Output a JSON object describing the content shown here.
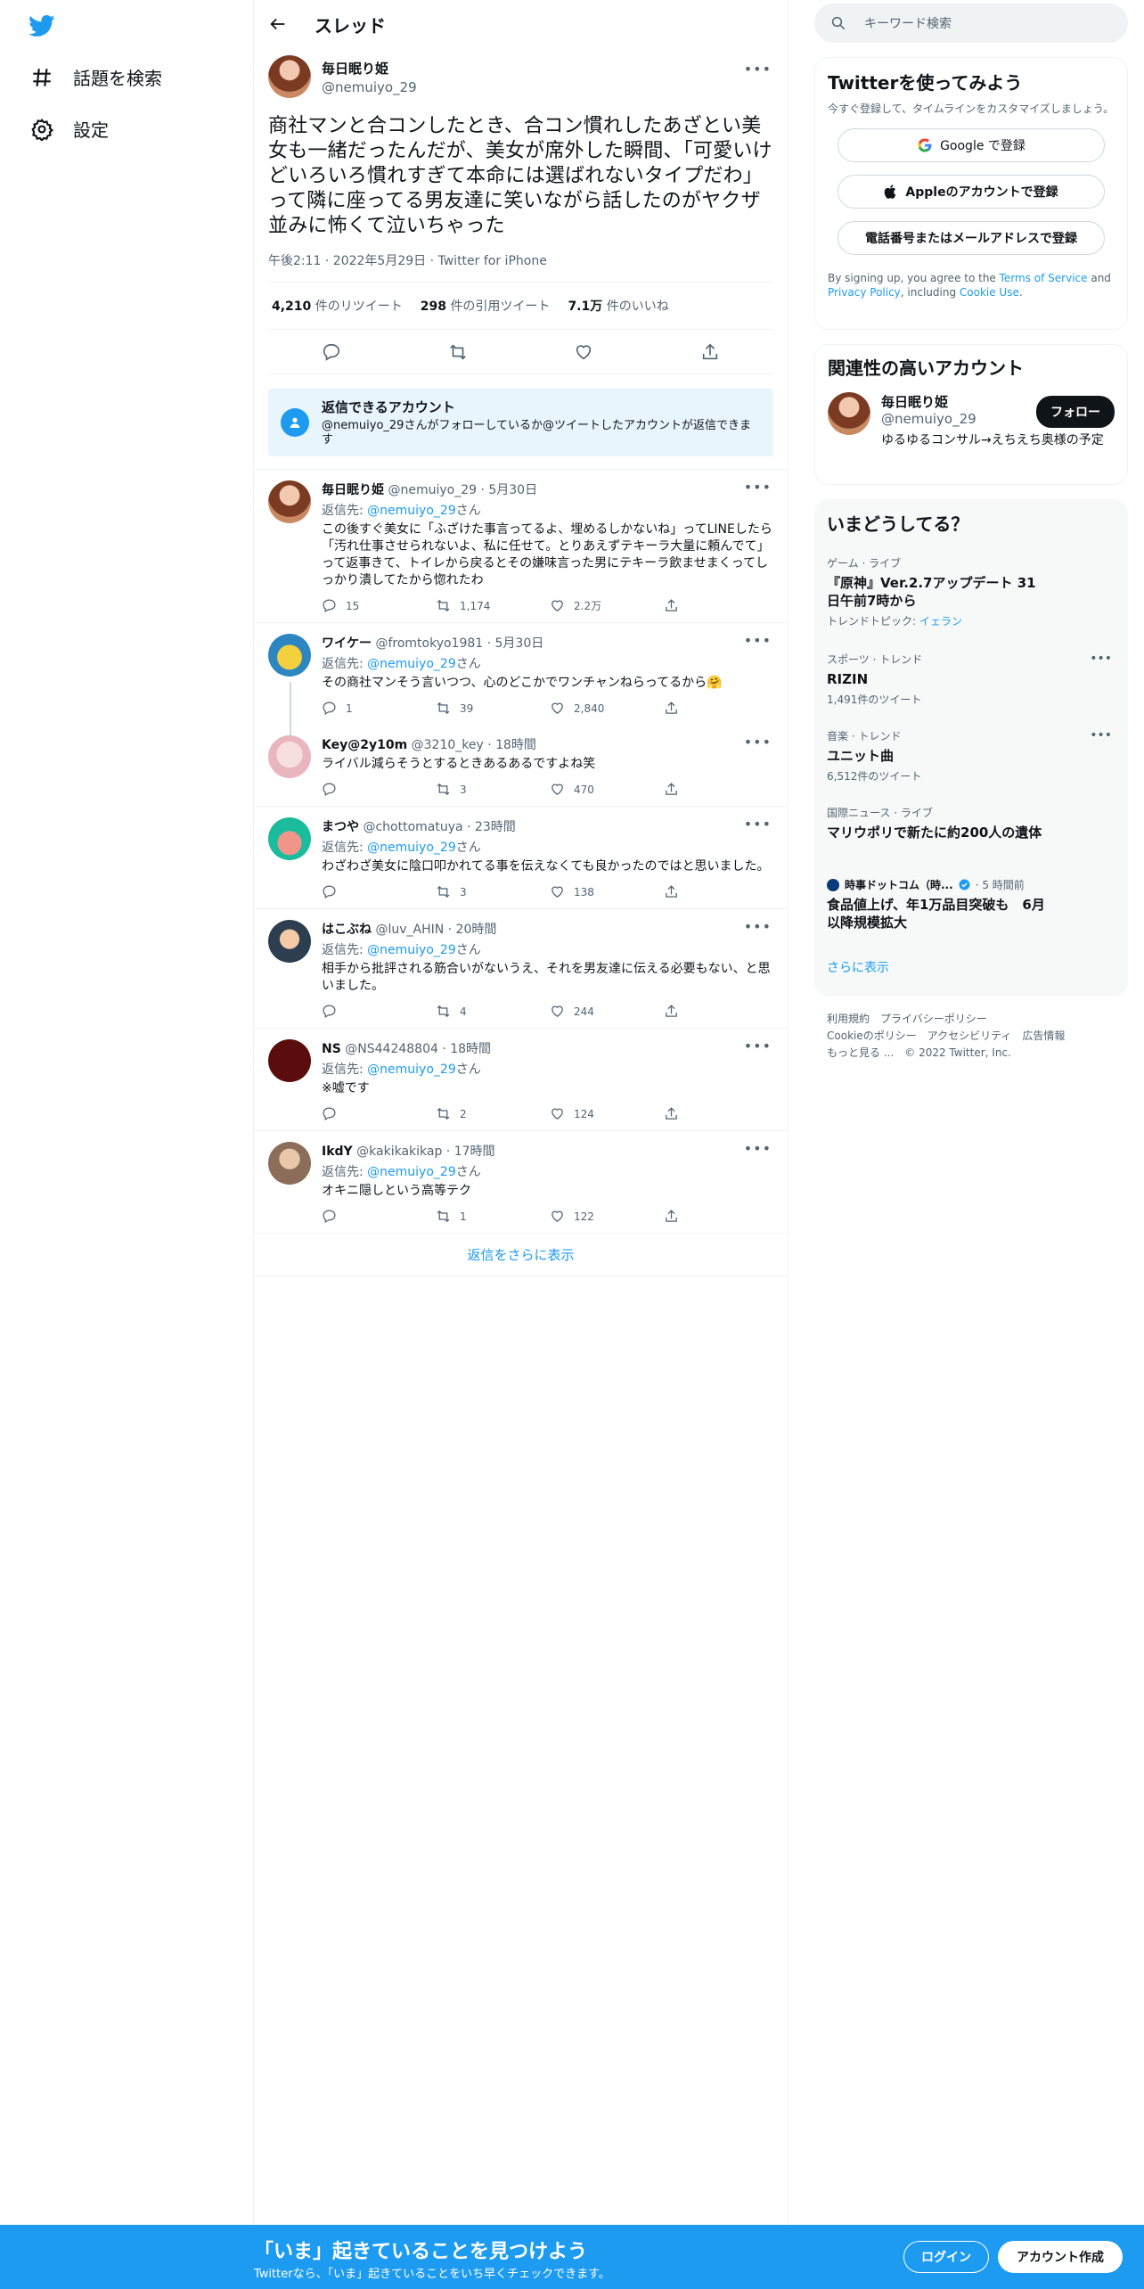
{
  "colors": {
    "accent": "#1d9bf0",
    "text": "#0f1419",
    "muted": "#536471"
  },
  "nav": {
    "explore_label": "話題を検索",
    "settings_label": "設定"
  },
  "header": {
    "title": "スレッド"
  },
  "tweet": {
    "name": "毎日眠り姫",
    "handle": "@nemuiyo_29",
    "text": "商社マンと合コンしたとき、合コン慣れしたあざとい美女も一緒だったんだが、美女が席外した瞬間、「可愛いけどいろいろ慣れすぎて本命には選ばれないタイプだわ」って隣に座ってる男友達に笑いながら話したのがヤクザ並みに怖くて泣いちゃった",
    "meta": "午後2:11 · 2022年5月29日 · Twitter for iPhone",
    "retweets": {
      "num": "4,210",
      "label": "件のリツイート"
    },
    "quotes": {
      "num": "298",
      "label": "件の引用ツイート"
    },
    "likes": {
      "num": "7.1万",
      "label": "件のいいね"
    }
  },
  "who_can_reply": {
    "title": "返信できるアカウント",
    "text": "@nemuiyo_29さんがフォローしているか@ツイートしたアカウントが返信できます"
  },
  "replies": [
    {
      "name": "毎日眠り姫",
      "meta": "@nemuiyo_29 · 5月30日",
      "reply_prefix": "返信先: ",
      "reply_to": "@nemuiyo_29",
      "reply_suffix": "さん",
      "text": "この後すぐ美女に「ふざけた事言ってるよ、埋めるしかないね」ってLINEしたら「汚れ仕事させられないよ、私に任せて。とりあえずテキーラ大量に頼んでて」って返事きて、トイレから戻るとその嫌味言った男にテキーラ飲ませまくってしっかり潰してたから惚れたわ",
      "reply": "15",
      "retweet": "1,174",
      "like": "2.2万"
    },
    {
      "name": "ワイケー",
      "meta": "@fromtokyo1981 · 5月30日",
      "reply_prefix": "返信先: ",
      "reply_to": "@nemuiyo_29",
      "reply_suffix": "さん",
      "text": "その商社マンそう言いつつ、心のどこかでワンチャンねらってるから🤗",
      "reply": "1",
      "retweet": "39",
      "like": "2,840"
    },
    {
      "name": "Key@2y10m",
      "meta": "@3210_key · 18時間",
      "text": "ライバル減らそうとするときあるあるですよね笑",
      "reply": "",
      "retweet": "3",
      "like": "470"
    },
    {
      "name": "まつや",
      "meta": "@chottomatuya · 23時間",
      "reply_prefix": "返信先: ",
      "reply_to": "@nemuiyo_29",
      "reply_suffix": "さん",
      "text": "わざわざ美女に陰口叩かれてる事を伝えなくても良かったのではと思いました。",
      "reply": "",
      "retweet": "3",
      "like": "138"
    },
    {
      "name": "はこぶね",
      "meta": "@luv_AHIN · 20時間",
      "reply_prefix": "返信先: ",
      "reply_to": "@nemuiyo_29",
      "reply_suffix": "さん",
      "text": "相手から批評される筋合いがないうえ、それを男友達に伝える必要もない、と思いました。",
      "reply": "",
      "retweet": "4",
      "like": "244"
    },
    {
      "name": "NS",
      "meta": "@NS44248804 · 18時間",
      "reply_prefix": "返信先: ",
      "reply_to": "@nemuiyo_29",
      "reply_suffix": "さん",
      "text": "※嘘です",
      "reply": "",
      "retweet": "2",
      "like": "124"
    },
    {
      "name": "IkdY",
      "meta": "@kakikakikap · 17時間",
      "reply_prefix": "返信先: ",
      "reply_to": "@nemuiyo_29",
      "reply_suffix": "さん",
      "text": "オキニ隠しという高等テク",
      "reply": "",
      "retweet": "1",
      "like": "122"
    }
  ],
  "show_more": "返信をさらに表示",
  "search": {
    "placeholder": "キーワード検索"
  },
  "signup": {
    "title": "Twitterを使ってみよう",
    "sub": "今すぐ登録して、タイムラインをカスタマイズしましょう。",
    "google": "Google で登録",
    "apple": "Appleのアカウントで登録",
    "phone": "電話番号またはメールアドレスで登録",
    "legal_1": "By signing up, you agree to the ",
    "tos": "Terms of Service",
    "legal_2": " and ",
    "privacy": "Privacy Policy",
    "legal_3": ", including ",
    "cookie": "Cookie Use",
    "legal_4": "."
  },
  "related": {
    "title": "関連性の高いアカウント",
    "name": "毎日眠り姫",
    "handle": "@nemuiyo_29",
    "follow": "フォロー",
    "bio": "ゆるゆるコンサル→えちえち奥様の予定"
  },
  "trends": {
    "title": "いまどうしてる？",
    "items": [
      {
        "cat": "ゲーム · ライブ",
        "name": "『原神』Ver.2.7アップデート 31日午前7時から",
        "count_prefix": "トレンドトピック: ",
        "count_link": "イェラン"
      },
      {
        "cat": "スポーツ · トレンド",
        "name": "RIZIN",
        "count": "1,491件のツイート"
      },
      {
        "cat": "音楽 · トレンド",
        "name": "ユニット曲",
        "count": "6,512件のツイート"
      },
      {
        "cat": "国際ニュース · ライブ",
        "name": "マリウポリで新たに約200人の遺体"
      }
    ],
    "news_source": "時事ドットコム（時...",
    "news_time": "· 5 時間前",
    "news_text": "食品値上げ、年1万品目突破も　6月以降規模拡大",
    "more": "さらに表示"
  },
  "footer": {
    "l1": "利用規約　プライバシーポリシー",
    "l2": "Cookieのポリシー　アクセシビリティ　広告情報",
    "l3": "もっと見る ...　© 2022 Twitter, Inc."
  },
  "banner": {
    "title": "「いま」起きていることを見つけよう",
    "sub": "Twitterなら、「いま」起きていることをいち早くチェックできます。",
    "login": "ログイン",
    "register": "アカウント作成"
  }
}
